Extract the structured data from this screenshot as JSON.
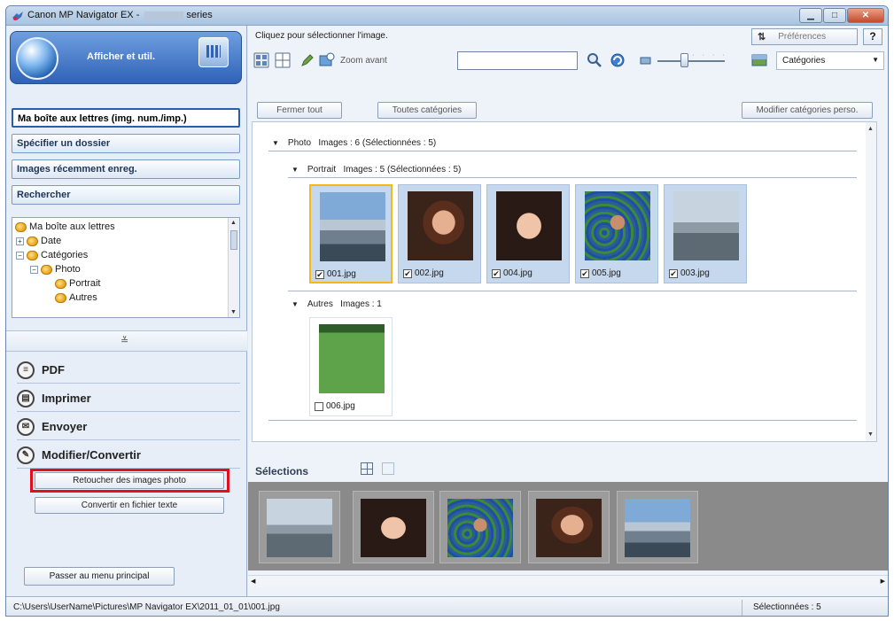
{
  "window": {
    "title_prefix": "Canon MP Navigator EX - ",
    "title_suffix": "series"
  },
  "left": {
    "header_label": "Afficher et util.",
    "nav": [
      {
        "label": "Ma boîte aux lettres (img. num./imp.)",
        "active": true
      },
      {
        "label": "Spécifier un dossier"
      },
      {
        "label": "Images récemment enreg."
      },
      {
        "label": "Rechercher"
      }
    ],
    "tree": [
      {
        "label": "Ma boîte aux lettres"
      },
      {
        "label": "Date"
      },
      {
        "label": "Catégories"
      },
      {
        "label": "Photo"
      },
      {
        "label": "Portrait"
      },
      {
        "label": "Autres"
      }
    ],
    "actions": [
      {
        "label": "PDF",
        "icon": "pdf-icon"
      },
      {
        "label": "Imprimer",
        "icon": "print-icon"
      },
      {
        "label": "Envoyer",
        "icon": "send-icon"
      },
      {
        "label": "Modifier/Convertir",
        "icon": "edit-convert-icon"
      }
    ],
    "sub_buttons": [
      "Retoucher des images photo",
      "Convertir en fichier texte"
    ],
    "main_menu_button": "Passer au menu principal"
  },
  "right": {
    "hint": "Cliquez pour sélectionner l'image.",
    "preferences": "Préférences",
    "help": "?",
    "zoom_label": "Zoom avant",
    "search_value": "",
    "category_select": "Catégories",
    "close_all": "Fermer tout",
    "all_categories": "Toutes catégories",
    "modify_categories": "Modifier catégories perso.",
    "groups": [
      {
        "title": "Photo",
        "stats": "Images : 6   (Sélectionnées : 5)"
      },
      {
        "title": "Portrait",
        "stats": "Images : 5   (Sélectionnées : 5)"
      },
      {
        "title": "Autres",
        "stats": "Images : 1"
      }
    ],
    "portrait_thumbs": [
      {
        "file": "001.jpg",
        "checked": true,
        "selected": true
      },
      {
        "file": "002.jpg",
        "checked": true
      },
      {
        "file": "004.jpg",
        "checked": true
      },
      {
        "file": "005.jpg",
        "checked": true
      },
      {
        "file": "003.jpg",
        "checked": true
      }
    ],
    "autres_thumbs": [
      {
        "file": "006.jpg",
        "checked": false
      }
    ],
    "selections_label": "Sélections"
  },
  "status": {
    "path": "C:\\Users\\UserName\\Pictures\\MP Navigator EX\\2011_01_01\\001.jpg",
    "selected_count": "Sélectionnées : 5"
  },
  "colors": {
    "highlight": "#e0101a",
    "selected_border": "#f5b814",
    "accent": "#2f62b8"
  }
}
